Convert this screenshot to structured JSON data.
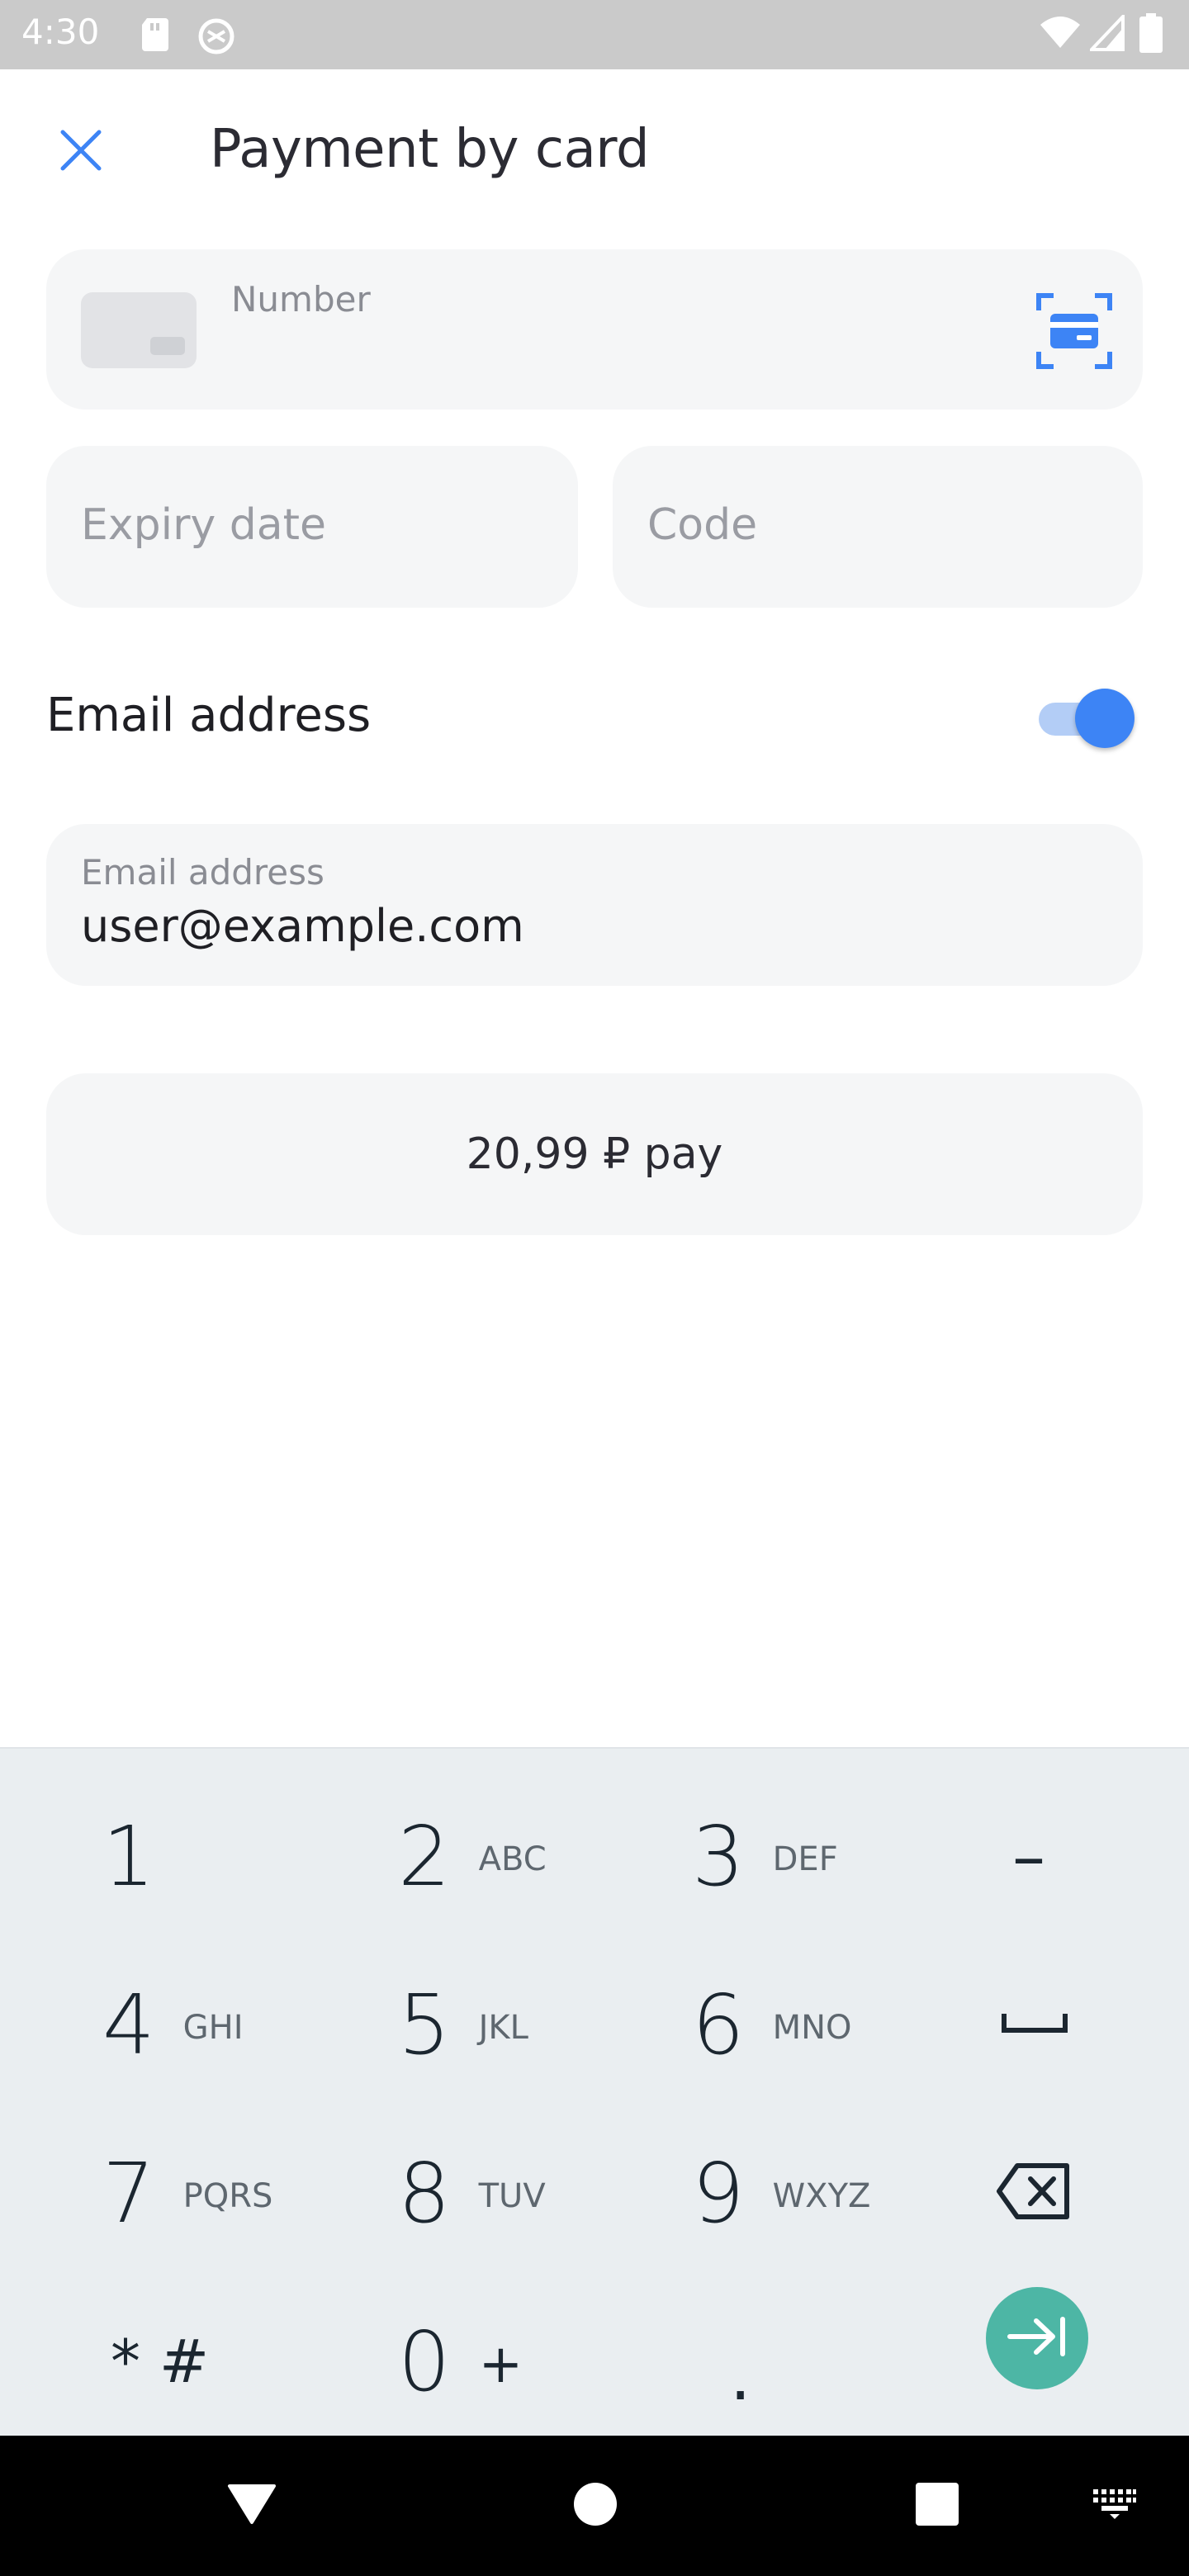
{
  "status_bar": {
    "time": "4:30",
    "left_icons": [
      "sd-card-icon",
      "sync-icon"
    ],
    "right_icons": [
      "wifi-icon",
      "signal-icon",
      "battery-icon"
    ]
  },
  "header": {
    "close_icon": "close-icon",
    "title": "Payment by card"
  },
  "form": {
    "card_number": {
      "label": "Number",
      "value": "",
      "scan_icon": "card-scan-icon"
    },
    "expiry": {
      "placeholder": "Expiry date",
      "value": ""
    },
    "code": {
      "placeholder": "Code",
      "value": ""
    },
    "email_toggle": {
      "label": "Email address",
      "checked": true
    },
    "email": {
      "label": "Email address",
      "value": "user@example.com"
    },
    "pay_button": {
      "label": "20,99 ₽ pay"
    }
  },
  "keyboard": {
    "rows": [
      [
        {
          "digit": "1",
          "letters": ""
        },
        {
          "digit": "2",
          "letters": "ABC"
        },
        {
          "digit": "3",
          "letters": "DEF"
        },
        {
          "symbol": "–"
        }
      ],
      [
        {
          "digit": "4",
          "letters": "GHI"
        },
        {
          "digit": "5",
          "letters": "JKL"
        },
        {
          "digit": "6",
          "letters": "MNO"
        },
        {
          "symbol": "space-icon"
        }
      ],
      [
        {
          "digit": "7",
          "letters": "PQRS"
        },
        {
          "digit": "8",
          "letters": "TUV"
        },
        {
          "digit": "9",
          "letters": "WXYZ"
        },
        {
          "symbol": "backspace-icon"
        }
      ],
      [
        {
          "digit": "* #",
          "letters": ""
        },
        {
          "digit": "0",
          "letters": "+"
        },
        {
          "digit": ".",
          "letters": ""
        },
        {
          "symbol": "next-field-icon"
        }
      ]
    ],
    "colors": {
      "background": "#eaeef1",
      "enter": "#4db6a5"
    }
  },
  "nav_bar": {
    "buttons": [
      "back-icon",
      "home-icon",
      "recents-icon",
      "keyboard-switch-icon"
    ]
  },
  "colors": {
    "accent": "#3d84f5",
    "field_bg": "#f5f6f7",
    "status_bar": "#cacaca"
  }
}
